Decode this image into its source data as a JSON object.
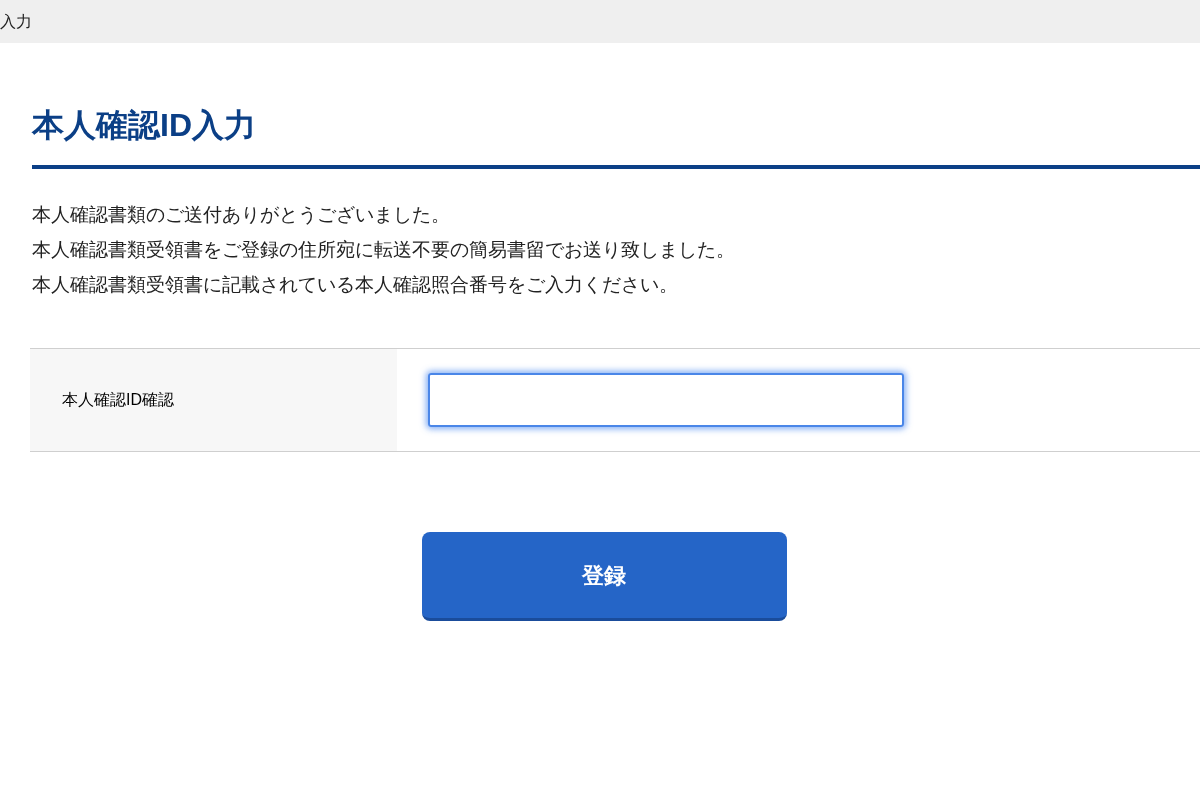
{
  "top_bar": {
    "title": "入力"
  },
  "heading": "本人確認ID入力",
  "messages": [
    "本人確認書類のご送付ありがとうございました。",
    "本人確認書類受領書をご登録の住所宛に転送不要の簡易書留でお送り致しました。",
    "本人確認書類受領書に記載されている本人確認照合番号をご入力ください。"
  ],
  "form": {
    "rows": [
      {
        "label": "本人確認ID確認",
        "focused": true
      }
    ]
  },
  "submit_button": {
    "label": "登録"
  }
}
